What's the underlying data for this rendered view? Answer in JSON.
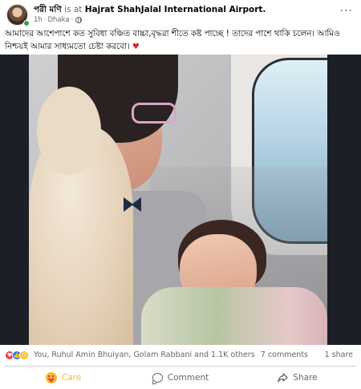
{
  "post": {
    "author": "পরী মণি",
    "is_at_text": "is at",
    "location": "Hajrat ShahJalal International Airport.",
    "time": "1h",
    "place_meta": "Dhaka",
    "separator": "·",
    "more_label": "···",
    "caption_line1": "আমাদের আশেপাশে কত সুবিধা বঞ্চিত বাচ্চা,বৃদ্ধরা শীতে কষ্ট পাচ্ছে ! তাদের পাশে থাকি চলেন। আমিও",
    "caption_line2": "নিশ্চয়ই আমার সাধ্যমতো চেষ্টা করবো।",
    "caption_emoji": "♥"
  },
  "reactions": {
    "icons": [
      "love-icon",
      "like-icon",
      "care-icon"
    ],
    "like_glyph": "👍",
    "love_glyph": "♥",
    "care_glyph": "☺",
    "names": "You, Ruhul Amin Bhuiyan, Golam Rabbani and 1.1K others",
    "comments": "7 comments",
    "shares": "1 share"
  },
  "actions": {
    "care_label": "Care",
    "comment_label": "Comment",
    "share_label": "Share"
  },
  "colors": {
    "care": "#f7b928",
    "love": "#f33e58",
    "like": "#1877f2",
    "muted_text": "#65676b",
    "online": "#31a24c"
  }
}
